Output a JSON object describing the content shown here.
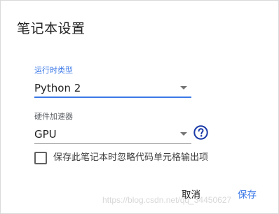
{
  "dialog": {
    "title": "笔记本设置"
  },
  "runtime": {
    "label": "运行时类型",
    "value": "Python 2"
  },
  "accelerator": {
    "label": "硬件加速器",
    "value": "GPU",
    "help_icon": "help-circle-icon"
  },
  "omit_code": {
    "label": "保存此笔记本时忽略代码单元格输出项",
    "checked": false
  },
  "buttons": {
    "cancel": "取消",
    "save": "保存"
  },
  "watermark": "https://blog.csdn.net/qq_34450627",
  "colors": {
    "accent": "#3b78e7",
    "help_icon": "#1a3aa8"
  }
}
